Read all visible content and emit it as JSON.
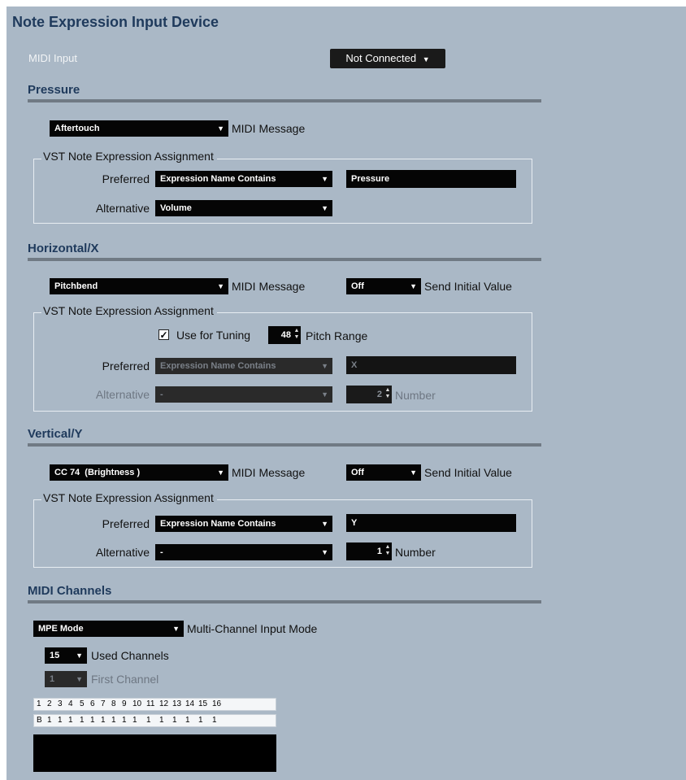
{
  "header": {
    "title": "Note Expression Input Device"
  },
  "midi_input": {
    "label": "MIDI Input",
    "value": "Not Connected"
  },
  "pressure": {
    "title": "Pressure",
    "midi_message_value": "Aftertouch",
    "midi_message_label": "MIDI Message",
    "group_label": "VST Note Expression Assignment",
    "preferred_label": "Preferred",
    "preferred_value": "Expression Name Contains",
    "preferred_text": "Pressure",
    "alternative_label": "Alternative",
    "alternative_value": "Volume"
  },
  "horizontal": {
    "title": "Horizontal/X",
    "midi_message_value": "Pitchbend",
    "midi_message_label": "MIDI Message",
    "initial_value": "Off",
    "initial_label": "Send Initial Value",
    "group_label": "VST Note Expression Assignment",
    "use_tuning_label": "Use for Tuning",
    "use_tuning_checked": true,
    "pitch_range_value": "48",
    "pitch_range_label": "Pitch Range",
    "preferred_label": "Preferred",
    "preferred_value": "Expression Name Contains",
    "preferred_text": "X",
    "alternative_label": "Alternative",
    "alternative_value": "-",
    "number_value": "2",
    "number_label": "Number"
  },
  "vertical": {
    "title": "Vertical/Y",
    "midi_message_value": "CC 74  (Brightness )",
    "midi_message_label": "MIDI Message",
    "initial_value": "Off",
    "initial_label": "Send Initial Value",
    "group_label": "VST Note Expression Assignment",
    "preferred_label": "Preferred",
    "preferred_value": "Expression Name Contains",
    "preferred_text": "Y",
    "alternative_label": "Alternative",
    "alternative_value": "-",
    "number_value": "1",
    "number_label": "Number"
  },
  "midi_channels": {
    "title": "MIDI Channels",
    "mode_value": "MPE Mode",
    "mode_label": "Multi-Channel Input Mode",
    "used_value": "15",
    "used_label": "Used Channels",
    "first_value": "1",
    "first_label": "First Channel",
    "channel_numbers": [
      "1",
      "2",
      "3",
      "4",
      "5",
      "6",
      "7",
      "8",
      "9",
      "10",
      "11",
      "12",
      "13",
      "14",
      "15",
      "16"
    ],
    "channel_states": [
      "B",
      "1",
      "1",
      "1",
      "1",
      "1",
      "1",
      "1",
      "1",
      "1",
      "1",
      "1",
      "1",
      "1",
      "1",
      "1"
    ]
  },
  "colors": {
    "panel_bg": "#aab8c6",
    "title": "#1f3a5c",
    "control_bg": "#050505"
  }
}
